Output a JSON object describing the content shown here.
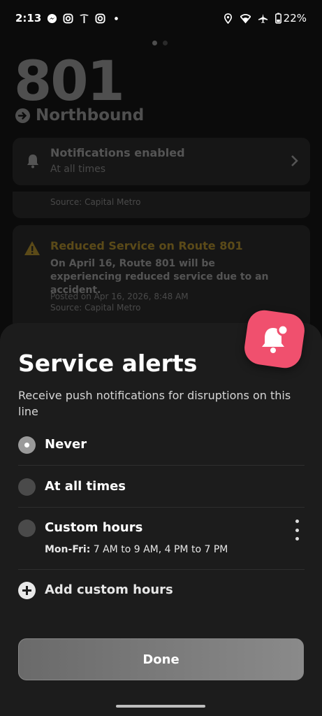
{
  "status_bar": {
    "time": "2:13",
    "battery": "22%",
    "left_icons": [
      "messenger-icon",
      "instagram-icon",
      "tesla-icon",
      "instagram-icon",
      "dot-icon"
    ],
    "right_icons": [
      "location-icon",
      "wifi-icon",
      "airplane-icon",
      "battery-icon"
    ]
  },
  "background": {
    "route_number": "801",
    "direction": "Northbound",
    "notifications_card": {
      "title": "Notifications enabled",
      "subtitle": "At all times"
    },
    "previous_alert": {
      "source": "Source: Capital Metro"
    },
    "alert_card": {
      "title": "Reduced Service on Route 801",
      "body": "On April 16, Route 801 will be experiencing reduced service due to an accident.",
      "posted": "Posted on Apr 16, 2026, 8:48 AM",
      "source": "Source: Capital Metro"
    }
  },
  "sheet": {
    "title": "Service alerts",
    "description": "Receive push notifications for disruptions on this line",
    "options": [
      {
        "label": "Never",
        "selected": true
      },
      {
        "label": "At all times",
        "selected": false
      },
      {
        "label": "Custom hours",
        "selected": false
      }
    ],
    "custom_hours_days": "Mon-Fri:",
    "custom_hours_times": " 7 AM to 9 AM, 4 PM to 7 PM",
    "add_custom_hours": "Add custom hours",
    "done_label": "Done"
  },
  "colors": {
    "accent_badge": "#f0506e",
    "alert_title": "#f0c030",
    "sheet_bg": "#1c1c1c"
  }
}
